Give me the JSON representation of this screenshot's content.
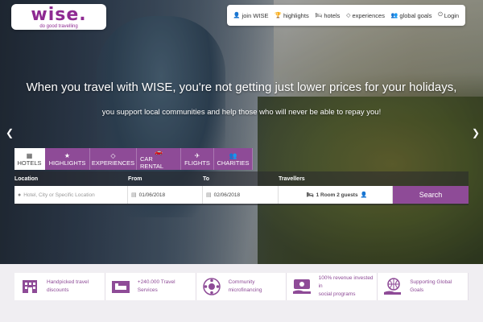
{
  "brand": {
    "name": "wise.",
    "tagline": "do good travelling",
    "color": "#8e2a92"
  },
  "topnav": [
    {
      "icon": "user-plus-icon",
      "label": "join WISE"
    },
    {
      "icon": "trophy-icon",
      "label": "highlights"
    },
    {
      "icon": "bed-icon",
      "label": "hotels"
    },
    {
      "icon": "diamond-icon",
      "label": "experiences"
    },
    {
      "icon": "users-icon",
      "label": "global goals"
    },
    {
      "icon": "login-icon",
      "label": "Login"
    }
  ],
  "hero": {
    "headline": "When you travel with WISE, you're not getting just lower prices for your holidays,",
    "subline": "you support local communities and help those who will never be able to repay you!"
  },
  "tabs": [
    {
      "icon": "building-icon",
      "label": "HOTELS",
      "active": true
    },
    {
      "icon": "star-icon",
      "label": "HIGHLIGHTS"
    },
    {
      "icon": "diamond-icon",
      "label": "EXPERIENCES"
    },
    {
      "icon": "car-icon",
      "label": "CAR RENTAL"
    },
    {
      "icon": "plane-icon",
      "label": "FLIGHTS"
    },
    {
      "icon": "users-icon",
      "label": "CHARITIES"
    }
  ],
  "search": {
    "location_label": "Location",
    "location_placeholder": "Hotel, City or Specific Location",
    "from_label": "From",
    "from_value": "01/06/2018",
    "to_label": "To",
    "to_value": "02/06/2018",
    "travellers_label": "Travellers",
    "travellers_value": "1 Room 2 guests",
    "button": "Search",
    "accent": "#8e4b97"
  },
  "features": [
    {
      "icon": "hotel-building-icon",
      "line1": "Handpicked travel",
      "line2": "discounts"
    },
    {
      "icon": "bed-board-icon",
      "line1": "+240.000 Travel",
      "line2": "Services"
    },
    {
      "icon": "coins-icon",
      "line1": "Community",
      "line2": "microfinancing"
    },
    {
      "icon": "money-hand-icon",
      "line1": "100% revenue invested in",
      "line2": "social programs"
    },
    {
      "icon": "globe-hand-icon",
      "line1": "Supporting Global",
      "line2": "Goals"
    }
  ]
}
